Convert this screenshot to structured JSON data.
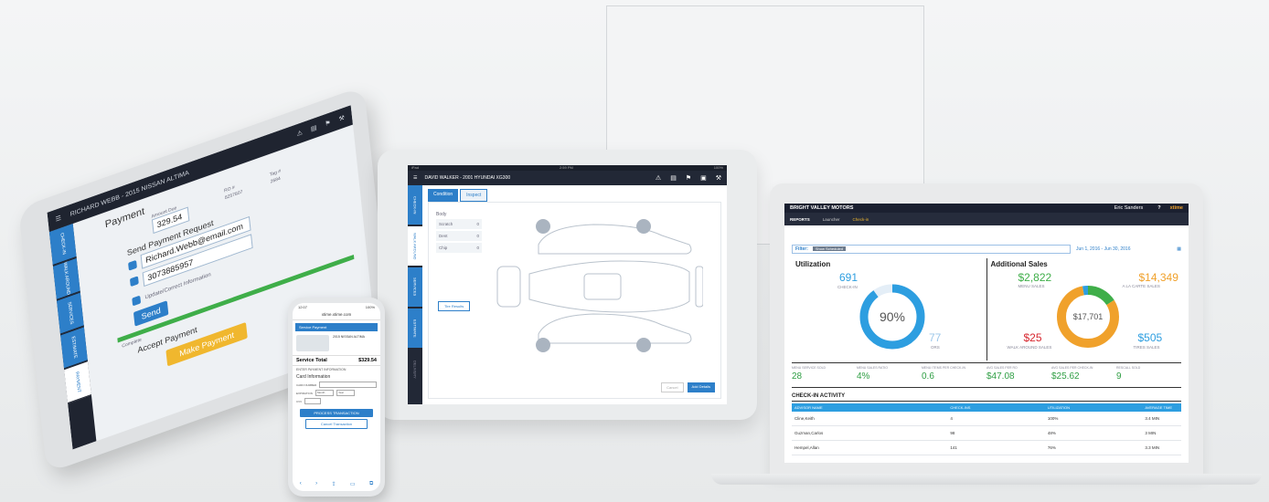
{
  "tablet_left": {
    "header": "RICHARD WEBB - 2015 NISSAN ALTIMA",
    "side_tabs": [
      "CHECK-IN",
      "WALK AROUND",
      "SERVICES",
      "ESTIMATE",
      "PAYMENT"
    ],
    "title": "Payment",
    "amount_due_label": "Amount Due",
    "amount": "329.54",
    "ro_label": "RO #",
    "ro_value": "8257807",
    "tag_label": "Tag #",
    "tag_value": "2684",
    "send_request_label": "Send Payment Request",
    "email": "Richard.Webb@email.com",
    "phone": "3073885957",
    "checkbox_label": "Update/Correct Information",
    "send_button": "Send",
    "complete_label": "Complete",
    "accept_label": "Accept Payment",
    "make_payment_button": "Make Payment"
  },
  "phone": {
    "time": "12:07",
    "battery": "100%",
    "url": "xtime.xtime.com",
    "section": "Service Payment",
    "vehicle": "2015 NISSAN ALTIMA",
    "service_total_label": "Service Total",
    "service_total": "$329.54",
    "enter_info": "ENTER PAYMENT INFORMATION",
    "card_info": "Card Information",
    "card_number_label": "CARD NUMBER",
    "expiration_label": "EXPIRATION",
    "month": "Month",
    "year": "Year",
    "cvv_label": "CVV",
    "process_button": "PROCESS TRANSACTION",
    "cancel_button": "Cancel Transaction"
  },
  "tablet_center": {
    "device": "iPad",
    "time": "2:59 PM",
    "battery": "100%",
    "title": "DAVID WALKER - 2001 HYUNDAI XG300",
    "side_tabs": [
      "CHECK-IN",
      "WALK AROUND",
      "SERVICES",
      "ESTIMATE",
      "DELIVERY"
    ],
    "tabs": [
      "Condition",
      "Inspect"
    ],
    "body_label": "Body",
    "damage": [
      {
        "label": "Scratch",
        "count": "0"
      },
      {
        "label": "Dent",
        "count": "0"
      },
      {
        "label": "Chip",
        "count": "0"
      }
    ],
    "tire_results": "Tire Results",
    "cancel_button": "Cancel",
    "add_details_button": "Add Details"
  },
  "laptop": {
    "dealer": "BRIGHT VALLEY MOTORS",
    "user": "Eric Sanders",
    "logo": "xtime",
    "nav": [
      "REPORTS",
      "Launcher",
      "Check-in"
    ],
    "filter_label": "Filter:",
    "filter_tag": "Show Scheduled",
    "date_range": "Jun 1, 2016 - Jun 30, 2016",
    "utilization": {
      "title": "Utilization",
      "checkin_value": "691",
      "checkin_label": "CHECK-IN",
      "percent": "90%",
      "percent_value": 90,
      "ro_value": "77",
      "ro_label": "ORS"
    },
    "additional_sales": {
      "title": "Additional Sales",
      "menu_value": "$2,822",
      "menu_label": "MENU SALES",
      "alacarte_value": "$14,349",
      "alacarte_label": "A LA CARTE SALES",
      "total": "$17,701",
      "walkaround_value": "$25",
      "walkaround_label": "WALK AROUND SALES",
      "tires_value": "$505",
      "tires_label": "TIRES SALES",
      "colors": {
        "green": "#3fae49",
        "orange": "#f0a12b",
        "blue": "#2d9ee0",
        "red": "#d7262e"
      }
    },
    "kpis": [
      {
        "label": "MENU SERVICE SOLD",
        "value": "28"
      },
      {
        "label": "MENU SALES RATIO",
        "value": "4%"
      },
      {
        "label": "MENU ITEMS PER CHECK-IN",
        "value": "0.6"
      },
      {
        "label": "AVG SALES PER RO",
        "value": "$47.08"
      },
      {
        "label": "AVG SALES PER CHECK-IN",
        "value": "$25.62"
      },
      {
        "label": "RESCALL SOLD",
        "value": "9"
      }
    ],
    "activity": {
      "title": "CHECK-IN ACTIVITY",
      "columns": [
        "ADVISOR NAME",
        "CHECK-INS",
        "UTILIZATION",
        "AVERAGE TIME"
      ],
      "rows": [
        [
          "Cline,Keith",
          "4",
          "100%",
          "3.4 MIN"
        ],
        [
          "Guzman,Carlos",
          "98",
          "48%",
          "3 MIN"
        ],
        [
          "Hempel,Allan",
          "141",
          "76%",
          "3.3 MIN"
        ]
      ]
    }
  }
}
